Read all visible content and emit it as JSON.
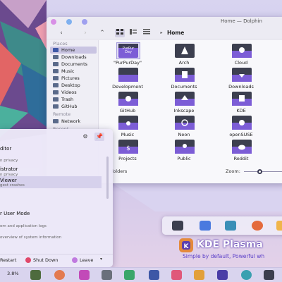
{
  "window": {
    "title": "Home — Dolphin"
  },
  "toolbar": {
    "back": "‹",
    "forward": "›",
    "up": "⌃",
    "path_sep": "▸",
    "path": "Home"
  },
  "sidebar": {
    "places_header": "Places",
    "places": [
      "Home",
      "Downloads",
      "Documents",
      "Music",
      "Pictures",
      "Desktop",
      "Videos",
      "Trash",
      "GitHub"
    ],
    "remote_header": "Remote",
    "remote": [
      "Network"
    ],
    "recent_header": "Recent"
  },
  "folders": [
    {
      "label": "\"PurPurDay\"",
      "tile": "PurPur Day"
    },
    {
      "label": "Arch"
    },
    {
      "label": "Cloud"
    },
    {
      "label": "Development"
    },
    {
      "label": "Documents"
    },
    {
      "label": "Downloads"
    },
    {
      "label": "GitHub"
    },
    {
      "label": "Inkscape"
    },
    {
      "label": "KDE"
    },
    {
      "label": "Music"
    },
    {
      "label": "Neon"
    },
    {
      "label": "openSUSE"
    },
    {
      "label": "Projects"
    },
    {
      "label": "Public"
    },
    {
      "label": "Reddit"
    }
  ],
  "statusbar": {
    "count": "folders",
    "zoom_label": "Zoom:"
  },
  "launcher": {
    "items": [
      {
        "title": "ditor",
        "sub": ""
      },
      {
        "title": "",
        "sub": "n privacy"
      },
      {
        "title": "istrator",
        "sub": "n privacy"
      },
      {
        "title": "Viewer",
        "sub": "gest crashes"
      },
      {
        "title": "r User Mode",
        "sub": ""
      },
      {
        "title": "",
        "sub": "em and application logs"
      },
      {
        "title": "",
        "sub": "overview of system information"
      }
    ],
    "restart": "Restart",
    "shutdown": "Shut Down",
    "leave": "Leave"
  },
  "taskbar": {
    "cpu": "3.8%"
  },
  "brand": {
    "title": "KDE Plasma",
    "subtitle": "Simple by default, Powerful wh"
  },
  "colors": {
    "accent": "#6b57c9",
    "selection": "#c9c4e2",
    "folder_purple": "#7c5dd6"
  }
}
